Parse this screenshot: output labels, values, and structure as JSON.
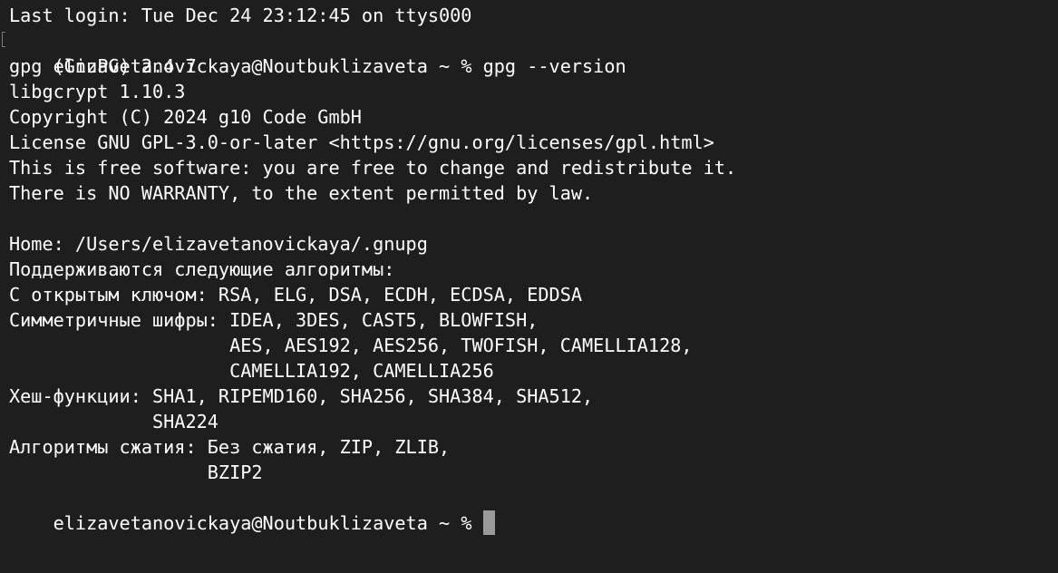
{
  "terminal": {
    "lines": [
      "Last login: Tue Dec 24 23:12:45 on ttys000",
      "elizavetanovickaya@Noutbuklizaveta ~ % gpg --version",
      "gpg (GnuPG) 2.4.7",
      "libgcrypt 1.10.3",
      "Copyright (C) 2024 g10 Code GmbH",
      "License GNU GPL-3.0-or-later <https://gnu.org/licenses/gpl.html>",
      "This is free software: you are free to change and redistribute it.",
      "There is NO WARRANTY, to the extent permitted by law.",
      "",
      "Home: /Users/elizavetanovickaya/.gnupg",
      "Поддерживаются следующие алгоритмы:",
      "С открытым ключом: RSA, ELG, DSA, ECDH, ECDSA, EDDSA",
      "Симметричные шифры: IDEA, 3DES, CAST5, BLOWFISH,",
      "                    AES, AES192, AES256, TWOFISH, CAMELLIA128,",
      "                    CAMELLIA192, CAMELLIA256",
      "Хеш-функции: SHA1, RIPEMD160, SHA256, SHA384, SHA512,",
      "             SHA224",
      "Алгоритмы сжатия: Без сжатия, ZIP, ZLIB,",
      "                  BZIP2"
    ],
    "prompt": "elizavetanovickaya@Noutbuklizaveta ~ % "
  }
}
